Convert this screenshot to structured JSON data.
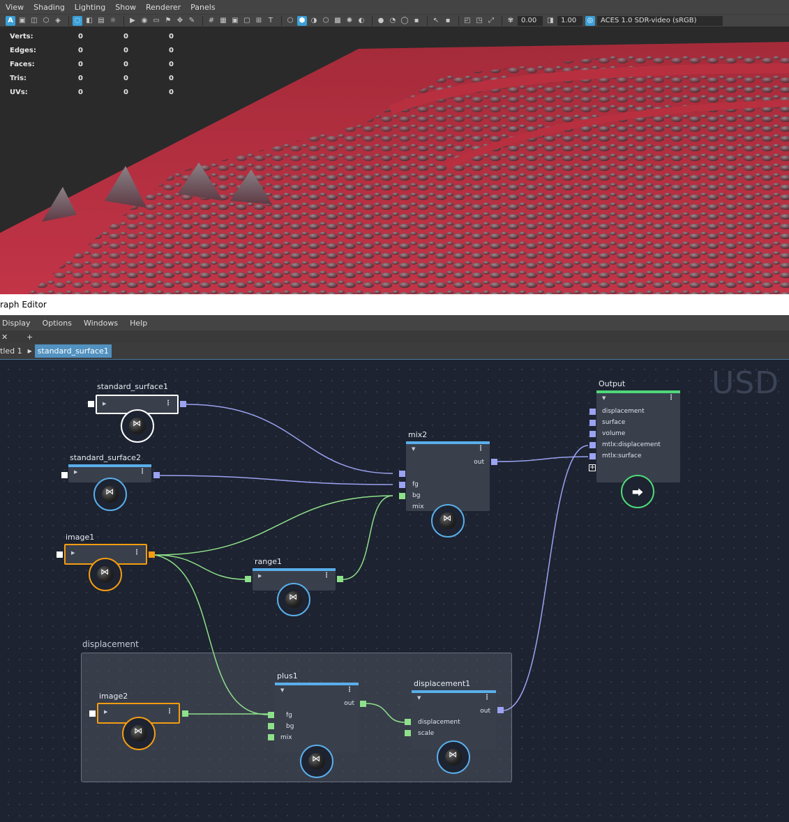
{
  "viewport": {
    "menu": [
      "View",
      "Shading",
      "Lighting",
      "Show",
      "Renderer",
      "Panels"
    ],
    "exposure": "0.00",
    "gamma": "1.00",
    "color_management": "ACES 1.0 SDR-video (sRGB)",
    "hud": [
      {
        "label": "Verts:",
        "values": [
          "0",
          "0",
          "0"
        ]
      },
      {
        "label": "Edges:",
        "values": [
          "0",
          "0",
          "0"
        ]
      },
      {
        "label": "Faces:",
        "values": [
          "0",
          "0",
          "0"
        ]
      },
      {
        "label": "Tris:",
        "values": [
          "0",
          "0",
          "0"
        ]
      },
      {
        "label": "UVs:",
        "values": [
          "0",
          "0",
          "0"
        ]
      }
    ]
  },
  "editor": {
    "title": "raph Editor",
    "menu": [
      "Display",
      "Options",
      "Windows",
      "Help"
    ],
    "tab_close": "✕",
    "tab_add": "+",
    "breadcrumb": {
      "parent": "tled 1",
      "current": "standard_surface1"
    },
    "watermark": "USD",
    "group_title": "displacement",
    "nodes": {
      "standard_surface1": "standard_surface1",
      "standard_surface2": "standard_surface2",
      "image1": "image1",
      "range1": "range1",
      "mix2": "mix2",
      "output": "Output",
      "image2": "image2",
      "plus1": "plus1",
      "displacement1": "displacement1"
    },
    "ports": {
      "mix2_out": "out",
      "mix2_fg": "fg",
      "mix2_bg": "bg",
      "mix2_mix": "mix",
      "out_displacement": "displacement",
      "out_surface": "surface",
      "out_volume": "volume",
      "out_mtlx_displacement": "mtlx:displacement",
      "out_mtlx_surface": "mtlx:surface",
      "plus1_out": "out",
      "plus1_fg": "fg",
      "plus1_bg": "bg",
      "plus1_mix": "mix",
      "disp_out": "out",
      "disp_displacement": "displacement",
      "disp_scale": "scale"
    },
    "colors": {
      "surface": "#9ba3f2",
      "float": "#8ee08a",
      "selected": "#f39c12",
      "output": "#4fd97a",
      "node_header": "#5aaeea"
    }
  }
}
